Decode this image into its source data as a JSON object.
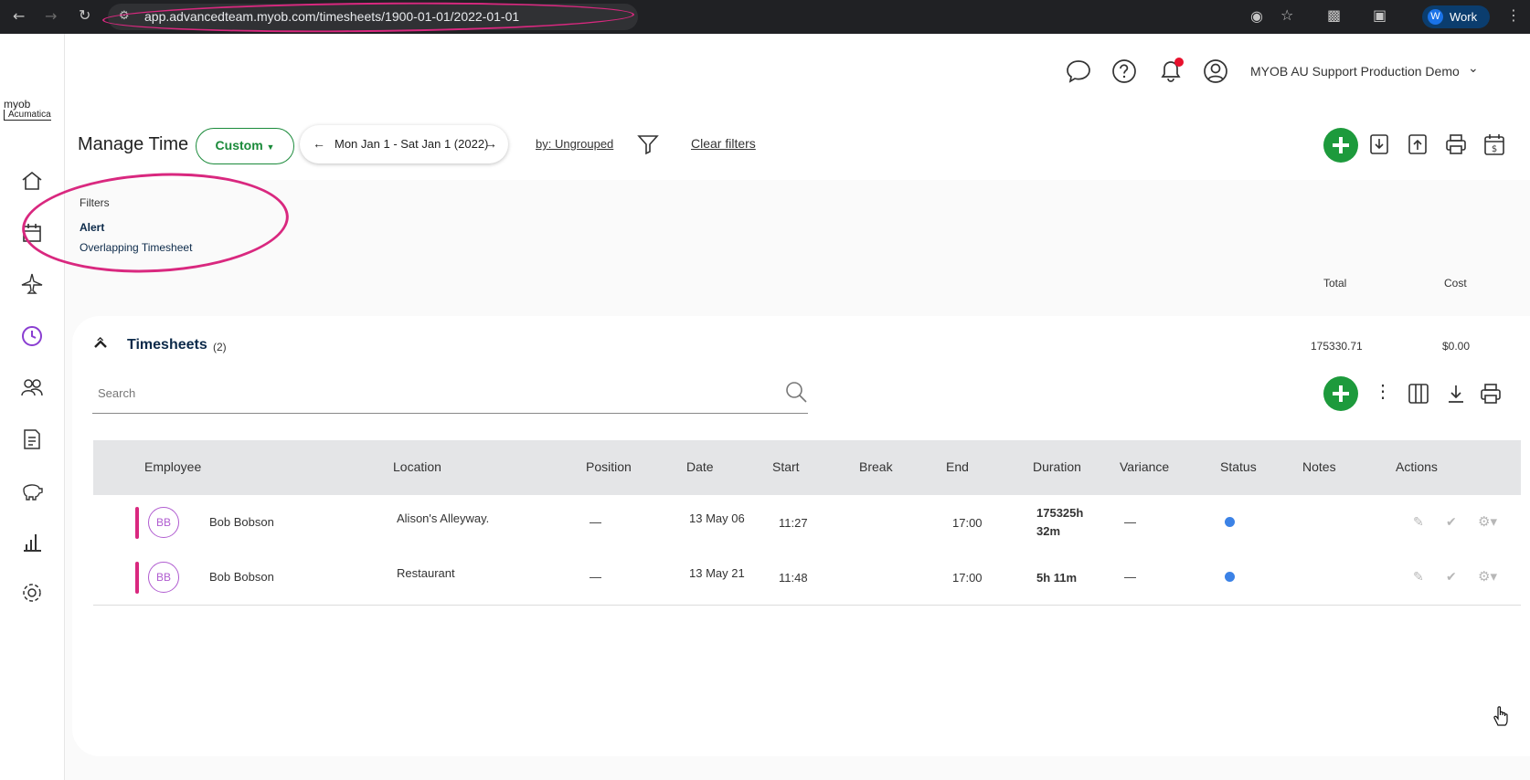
{
  "browser": {
    "url": "app.advancedteam.myob.com/timesheets/1900-01-01/2022-01-01",
    "profile_initial": "W",
    "profile_name": "Work"
  },
  "brand": {
    "logo_line1": "myob",
    "logo_line2": "Acumatica"
  },
  "header": {
    "company": "MYOB AU Support Production Demo",
    "title": "Manage Time",
    "custom_label": "Custom",
    "date_range": "Mon Jan 1 - Sat Jan 1 (2022)",
    "group_by": "by: Ungrouped",
    "clear_filters": "Clear filters"
  },
  "filters": {
    "heading": "Filters",
    "group": "Alert",
    "value": "Overlapping Timesheet"
  },
  "totals": {
    "total_label": "Total",
    "cost_label": "Cost",
    "total_value": "175330.71",
    "cost_value": "$0.00"
  },
  "section": {
    "title": "Timesheets",
    "count": "(2)"
  },
  "search": {
    "placeholder": "Search"
  },
  "table": {
    "columns": [
      "Employee",
      "Location",
      "Position",
      "Date",
      "Start",
      "Break",
      "End",
      "Duration",
      "Variance",
      "Status",
      "Notes",
      "Actions"
    ],
    "rows": [
      {
        "initials": "BB",
        "employee": "Bob Bobson",
        "location": "Alison's Alleyway.",
        "position": "—",
        "date": "13 May 06",
        "start": "11:27",
        "break": "",
        "end": "17:00",
        "duration_line1": "175325h",
        "duration_line2": "32m",
        "variance": "—",
        "status": "submitted"
      },
      {
        "initials": "BB",
        "employee": "Bob Bobson",
        "location": "Restaurant",
        "position": "—",
        "date": "13 May 21",
        "start": "11:48",
        "break": "",
        "end": "17:00",
        "duration_line1": "5h 11m",
        "duration_line2": "",
        "variance": "—",
        "status": "submitted"
      }
    ]
  },
  "colors": {
    "accent_green": "#1d9a3c",
    "highlight_pink": "#d9287f",
    "status_blue": "#3b82e6",
    "notification_red": "#e8112d"
  }
}
